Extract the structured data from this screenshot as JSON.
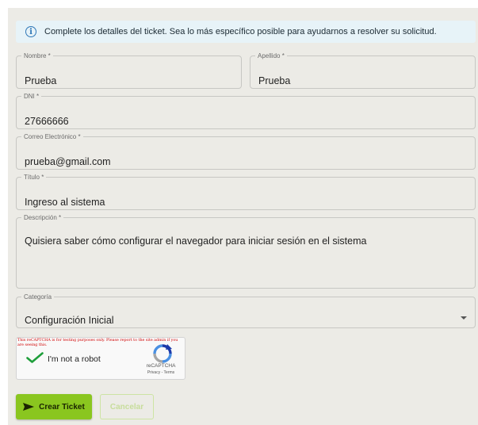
{
  "alert": {
    "icon": "info-icon",
    "text": "Complete los detalles del ticket. Sea lo más específico posible para ayudarnos a resolver su solicitud."
  },
  "form": {
    "nombre": {
      "label": "Nombre *",
      "value": "Prueba"
    },
    "apellido": {
      "label": "Apellido *",
      "value": "Prueba"
    },
    "dni": {
      "label": "DNI *",
      "value": "27666666"
    },
    "correo": {
      "label": "Correo Electrónico *",
      "value": "prueba@gmail.com"
    },
    "titulo": {
      "label": "Título *",
      "value": "Ingreso al sistema"
    },
    "descripcion": {
      "label": "Descripción *",
      "value": "Quisiera saber cómo configurar el navegador para iniciar sesión en el sistema"
    },
    "categoria": {
      "label": "Categoría",
      "value": "Configuración Inicial"
    }
  },
  "captcha": {
    "warning": "This reCAPTCHA is for testing purposes only. Please report to the site admin if you are seeing this.",
    "label": "I'm not a robot",
    "brand": "reCAPTCHA",
    "links": "Privacy - Terms",
    "checked": true
  },
  "actions": {
    "create_label": "Crear Ticket",
    "cancel_label": "Cancelar"
  },
  "colors": {
    "primary": "#8ac61f",
    "alert_bg": "#e7f3f8",
    "info": "#2f77b7",
    "panel_bg": "#ecebe6"
  }
}
